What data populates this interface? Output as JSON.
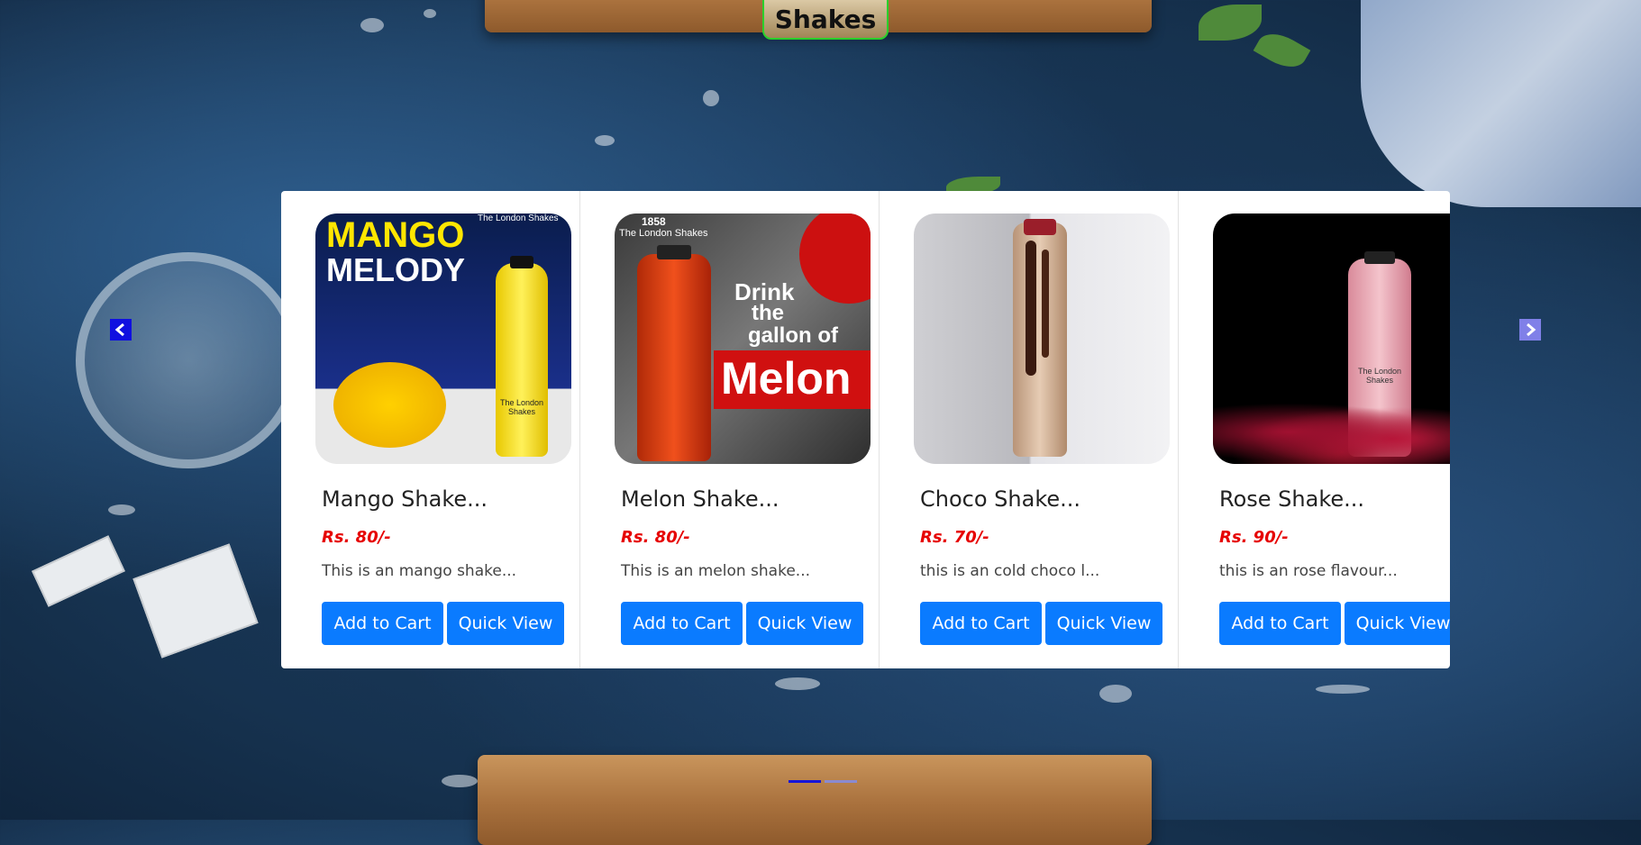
{
  "section": {
    "title": "Shakes"
  },
  "carousel": {
    "prev_label": "‹",
    "next_label": "›",
    "products": [
      {
        "name": "Mango Shake...",
        "price": "Rs. 80/-",
        "description": "This is an mango shake...",
        "add_label": "Add to Cart",
        "quick_label": "Quick View",
        "image": {
          "line1": "MANGO",
          "line2": "MELODY",
          "brand": "The London Shakes",
          "bottle_text": "The London Shakes"
        }
      },
      {
        "name": "Melon Shake...",
        "price": "Rs. 80/-",
        "description": "This is an melon shake...",
        "add_label": "Add to Cart",
        "quick_label": "Quick View",
        "image": {
          "year": "1858",
          "brand": "The London Shakes",
          "line1": "Drink",
          "line2": "the",
          "line3": "gallon of",
          "line4": "Melon"
        }
      },
      {
        "name": "Choco Shake...",
        "price": "Rs. 70/-",
        "description": "this is an cold choco l...",
        "add_label": "Add to Cart",
        "quick_label": "Quick View",
        "image": {}
      },
      {
        "name": "Rose Shake...",
        "price": "Rs. 90/-",
        "description": "this is an rose flavour...",
        "add_label": "Add to Cart",
        "quick_label": "Quick View",
        "image": {
          "bottle_text": "The London Shakes"
        }
      }
    ],
    "active_slide": 1,
    "slide_count": 2
  },
  "colors": {
    "price": "#e60000",
    "button": "#0a7bff",
    "title_border": "#2bd02b"
  }
}
